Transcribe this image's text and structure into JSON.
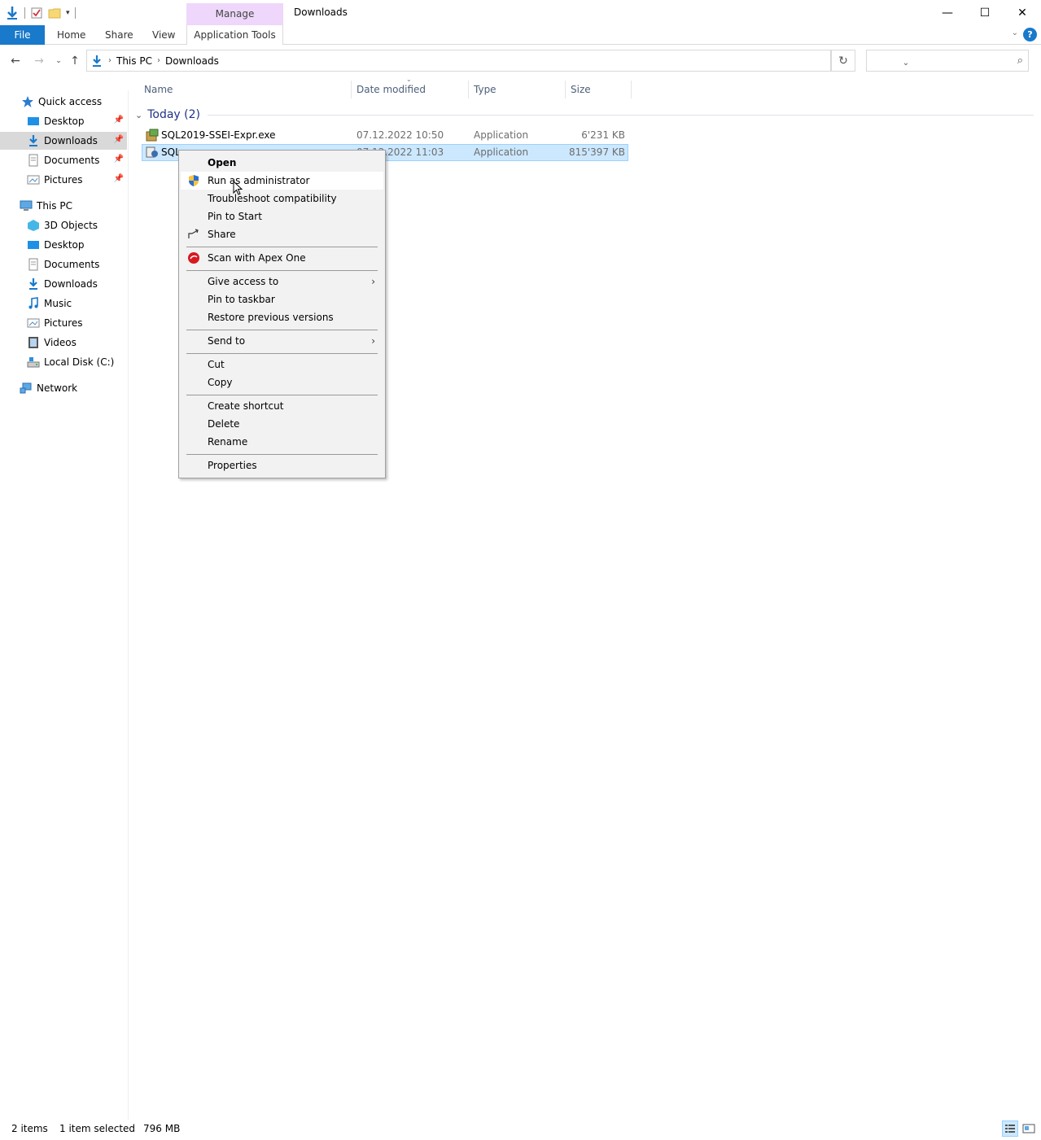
{
  "window": {
    "title": "Downloads",
    "manage_tab": "Manage",
    "minimize": "—",
    "maximize": "☐",
    "close": "✕"
  },
  "ribbon": {
    "file": "File",
    "home": "Home",
    "share": "Share",
    "view": "View",
    "application_tools": "Application Tools",
    "help": "?"
  },
  "address": {
    "crumbs": [
      "This PC",
      "Downloads"
    ],
    "search_placeholder": ""
  },
  "nav": {
    "quick_access": "Quick access",
    "quick_items": [
      "Desktop",
      "Downloads",
      "Documents",
      "Pictures"
    ],
    "this_pc": "This PC",
    "pc_items": [
      "3D Objects",
      "Desktop",
      "Documents",
      "Downloads",
      "Music",
      "Pictures",
      "Videos",
      "Local Disk (C:)"
    ],
    "network": "Network"
  },
  "columns": {
    "name": "Name",
    "date": "Date modified",
    "type": "Type",
    "size": "Size"
  },
  "group": {
    "label": "Today (2)"
  },
  "files": [
    {
      "name": "SQL2019-SSEI-Expr.exe",
      "date": "07.12.2022 10:50",
      "type": "Application",
      "size": "6'231 KB"
    },
    {
      "name": "SQL",
      "date": "07.12.2022 11:03",
      "type": "Application",
      "size": "815'397 KB"
    }
  ],
  "context_menu": {
    "open": "Open",
    "run_as_admin": "Run as administrator",
    "troubleshoot": "Troubleshoot compatibility",
    "pin_start": "Pin to Start",
    "share": "Share",
    "scan": "Scan with Apex One",
    "give_access": "Give access to",
    "pin_taskbar": "Pin to taskbar",
    "restore": "Restore previous versions",
    "send_to": "Send to",
    "cut": "Cut",
    "copy": "Copy",
    "create_shortcut": "Create shortcut",
    "delete": "Delete",
    "rename": "Rename",
    "properties": "Properties"
  },
  "status": {
    "items": "2 items",
    "selected": "1 item selected",
    "size": "796 MB"
  },
  "colors": {
    "file_tab": "#1979ca",
    "manage_tab": "#eed7fa",
    "selection": "#cce8ff",
    "group_text": "#1e3287"
  }
}
